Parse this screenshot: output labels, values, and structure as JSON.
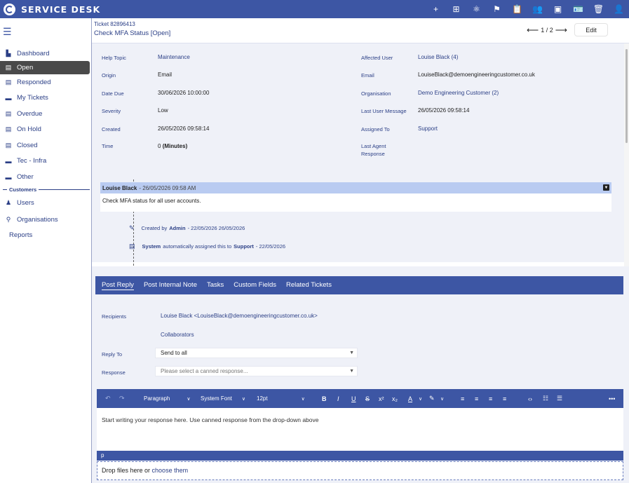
{
  "app": {
    "title": "SERVICE DESK"
  },
  "topbar": {
    "icons": [
      {
        "name": "plus-icon",
        "glyph": "+"
      },
      {
        "name": "new-window-icon",
        "glyph": "⊞"
      },
      {
        "name": "atom-icon",
        "glyph": "⚛"
      },
      {
        "name": "flag-icon",
        "glyph": "⚑"
      },
      {
        "name": "clipboard-icon",
        "glyph": "📋"
      },
      {
        "name": "group-icon",
        "glyph": "👥"
      },
      {
        "name": "image-icon",
        "glyph": "▣"
      },
      {
        "name": "id-card-icon",
        "glyph": "🪪"
      },
      {
        "name": "trash-icon",
        "glyph": "🗑"
      },
      {
        "name": "user-icon",
        "glyph": "👤"
      }
    ]
  },
  "sidebar": {
    "items": [
      {
        "label": "Dashboard",
        "icon": "▙",
        "active": false
      },
      {
        "label": "Open",
        "icon": "▤",
        "active": true
      },
      {
        "label": "Responded",
        "icon": "▤",
        "active": false
      },
      {
        "label": "My Tickets",
        "icon": "▬",
        "active": false
      },
      {
        "label": "Overdue",
        "icon": "▤",
        "active": false
      },
      {
        "label": "On Hold",
        "icon": "▤",
        "active": false
      },
      {
        "label": "Closed",
        "icon": "▤",
        "active": false
      },
      {
        "label": "Tec - Infra",
        "icon": "▬",
        "active": false
      },
      {
        "label": "Other",
        "icon": "▬",
        "active": false
      }
    ],
    "section": "Customers",
    "customer_items": [
      {
        "label": "Users",
        "icon": "♟"
      },
      {
        "label": "Organisations",
        "icon": "⚲"
      }
    ],
    "reports": "Reports"
  },
  "ticket": {
    "number": "Ticket 82896413",
    "title": "Check MFA Status [Open]",
    "pager": "1 / 2",
    "edit_label": "Edit",
    "left_fields": [
      {
        "label": "Help Topic",
        "value": "Maintenance",
        "link": true
      },
      {
        "label": "Origin",
        "value": "Email",
        "link": false
      },
      {
        "label": "Date Due",
        "value": "30/06/2026 10:00:00",
        "link": false
      },
      {
        "label": "Severity",
        "value": "Low",
        "link": false
      },
      {
        "label": "Created",
        "value": "26/05/2026 09:58:14",
        "link": false
      }
    ],
    "time": {
      "label": "Time",
      "value": "0",
      "unit": "(Minutes)"
    },
    "right_fields": [
      {
        "label": "Affected User",
        "value": "Louise Black (4)",
        "link": true
      },
      {
        "label": "Email",
        "value": "LouiseBlack@demoengineeringcustomer.co.uk",
        "link": false
      },
      {
        "label": "Organisation",
        "value": "Demo Engineering Customer (2)",
        "link": true
      },
      {
        "label": "Last User Message",
        "value": "26/05/2026 09:58:14",
        "link": false
      },
      {
        "label": "Assigned To",
        "value": "Support",
        "link": true
      }
    ],
    "last_agent": {
      "label_line1": "Last Agent",
      "label_line2": "Response"
    }
  },
  "thread": {
    "author": "Louise Black",
    "timestamp": "- 26/05/2026 09:58 AM",
    "body": "Check MFA status for all user accounts.",
    "event1": {
      "prefix": "Created by",
      "actor": "Admin",
      "suffix": "- 22/05/2026 26/05/2026"
    },
    "event2": {
      "actor": "System",
      "middle": "automatically assigned this to",
      "target": "Support",
      "suffix": "- 22/05/2026"
    }
  },
  "reply": {
    "tabs": [
      "Post Reply",
      "Post Internal Note",
      "Tasks",
      "Custom Fields",
      "Related Tickets"
    ],
    "recipients_label": "Recipients",
    "recipients_value": "Louise Black <LouiseBlack@demoengineeringcustomer.co.uk>",
    "collaborators": "Collaborators",
    "reply_to_label": "Reply To",
    "reply_to_value": "Send to all",
    "response_label": "Response",
    "response_placeholder": "Please select a canned response...",
    "editor": {
      "block_format": "Paragraph",
      "font": "System Font",
      "size": "12pt",
      "placeholder": "Start writing your response here. Use canned response from the drop-down above",
      "status": "p"
    },
    "dropzone_text": "Drop files here or",
    "dropzone_link": "choose them"
  }
}
